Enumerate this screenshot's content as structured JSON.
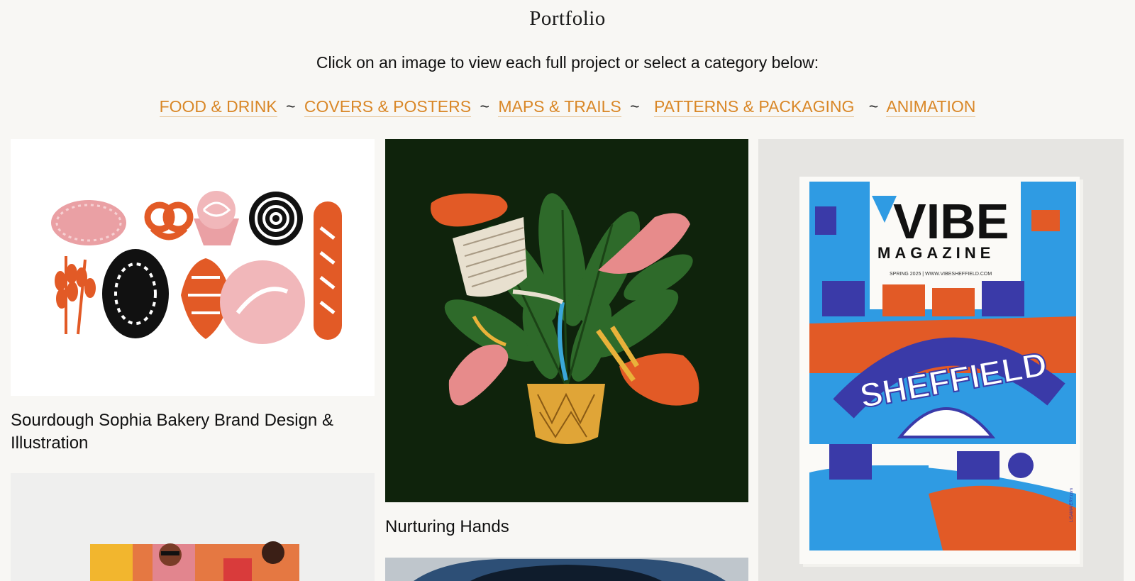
{
  "page": {
    "title": "Portfolio",
    "intro": "Click on an image to view each full project or select a category below:"
  },
  "categories": [
    {
      "label": "FOOD & DRINK"
    },
    {
      "label": "COVERS & POSTERS"
    },
    {
      "label": "MAPS & TRAILS"
    },
    {
      "label": "PATTERNS & PACKAGING"
    },
    {
      "label": "ANIMATION"
    }
  ],
  "separator": "~",
  "projects": [
    {
      "caption": "Sourdough Sophia Bakery Brand Design & Illustration"
    },
    {
      "caption": "Nurturing Hands"
    },
    {
      "caption": ""
    }
  ],
  "magazine": {
    "brand": "VIBE",
    "subtitle": "MAGAZINE",
    "issue_line": "SPRING 2025 | WWW.VIBESHEFFIELD.COM",
    "city": "SHEFFIELD",
    "side_url": "LISAMAIERY.com"
  },
  "colors": {
    "accent": "#d98727",
    "background": "#f8f7f4",
    "plant_bg": "#0f230c",
    "hand_orange": "#e25a26",
    "hand_pink": "#e78b8b",
    "magazine_blue": "#2f9be3",
    "magazine_navy": "#3a3aa8"
  }
}
